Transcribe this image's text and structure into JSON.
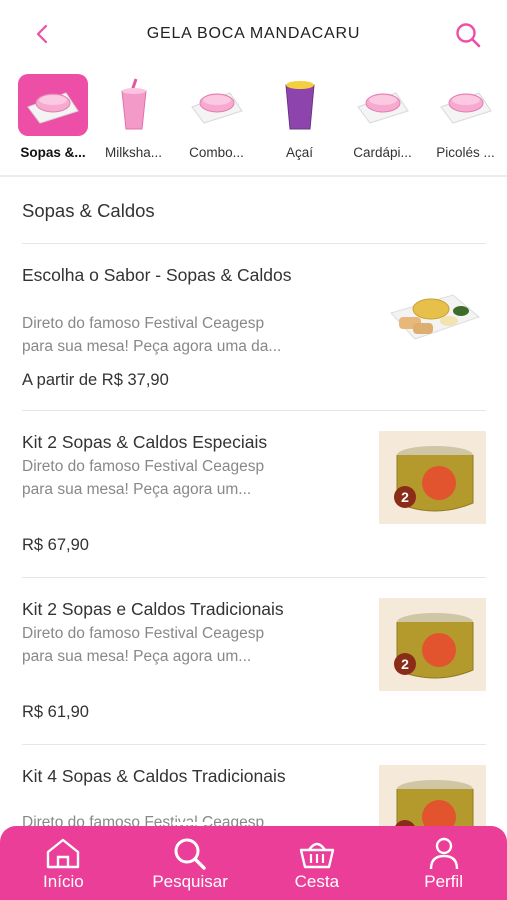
{
  "header": {
    "title": "GELA BOCA MANDACARU",
    "back_icon": "chevron-left-icon",
    "search_icon": "search-icon",
    "accent": "#ee4fa6"
  },
  "categories": [
    {
      "label": "Sopas &...",
      "icon": "bowl-icon",
      "active": true
    },
    {
      "label": "Milksha...",
      "icon": "milkshake-cup-icon",
      "active": false
    },
    {
      "label": "Combo...",
      "icon": "bowl-icon",
      "active": false
    },
    {
      "label": "Açaí",
      "icon": "acai-cup-icon",
      "active": false
    },
    {
      "label": "Cardápi...",
      "icon": "bowl-icon",
      "active": false
    },
    {
      "label": "Picolés ...",
      "icon": "bowl-icon",
      "active": false
    }
  ],
  "section": {
    "title": "Sopas & Caldos"
  },
  "items": [
    {
      "name": "Escolha o Sabor - Sopas & Caldos",
      "description_line1": "Direto do famoso Festival Ceagesp",
      "description_line2": "para sua mesa! Peça agora uma da...",
      "price": "A partir de R$ 37,90",
      "thumb": "soup-plate-image"
    },
    {
      "name": "Kit 2 Sopas & Caldos Especiais",
      "description_line1": "Direto do famoso Festival Ceagesp",
      "description_line2": "para sua mesa! Peça agora um...",
      "price": "R$ 67,90",
      "thumb": "soup-pot-image",
      "badge": "2"
    },
    {
      "name": "Kit 2 Sopas e Caldos Tradicionais",
      "description_line1": "Direto do famoso Festival Ceagesp",
      "description_line2": "para sua mesa! Peça agora um...",
      "price": "R$ 61,90",
      "thumb": "soup-pot-image",
      "badge": "2"
    },
    {
      "name": "Kit 4 Sopas & Caldos Tradicionais",
      "description_line1": "Direto do famoso Festival Ceagesp",
      "thumb": "soup-pot-image",
      "badge": "4"
    }
  ],
  "bottom_nav": [
    {
      "label": "Início",
      "icon": "home-icon",
      "active": false
    },
    {
      "label": "Pesquisar",
      "icon": "search-icon",
      "active": true
    },
    {
      "label": "Cesta",
      "icon": "basket-icon",
      "active": false
    },
    {
      "label": "Perfil",
      "icon": "person-icon",
      "active": false
    }
  ],
  "colors": {
    "brand_pink": "#ea3e98",
    "text_gray": "#888888"
  }
}
